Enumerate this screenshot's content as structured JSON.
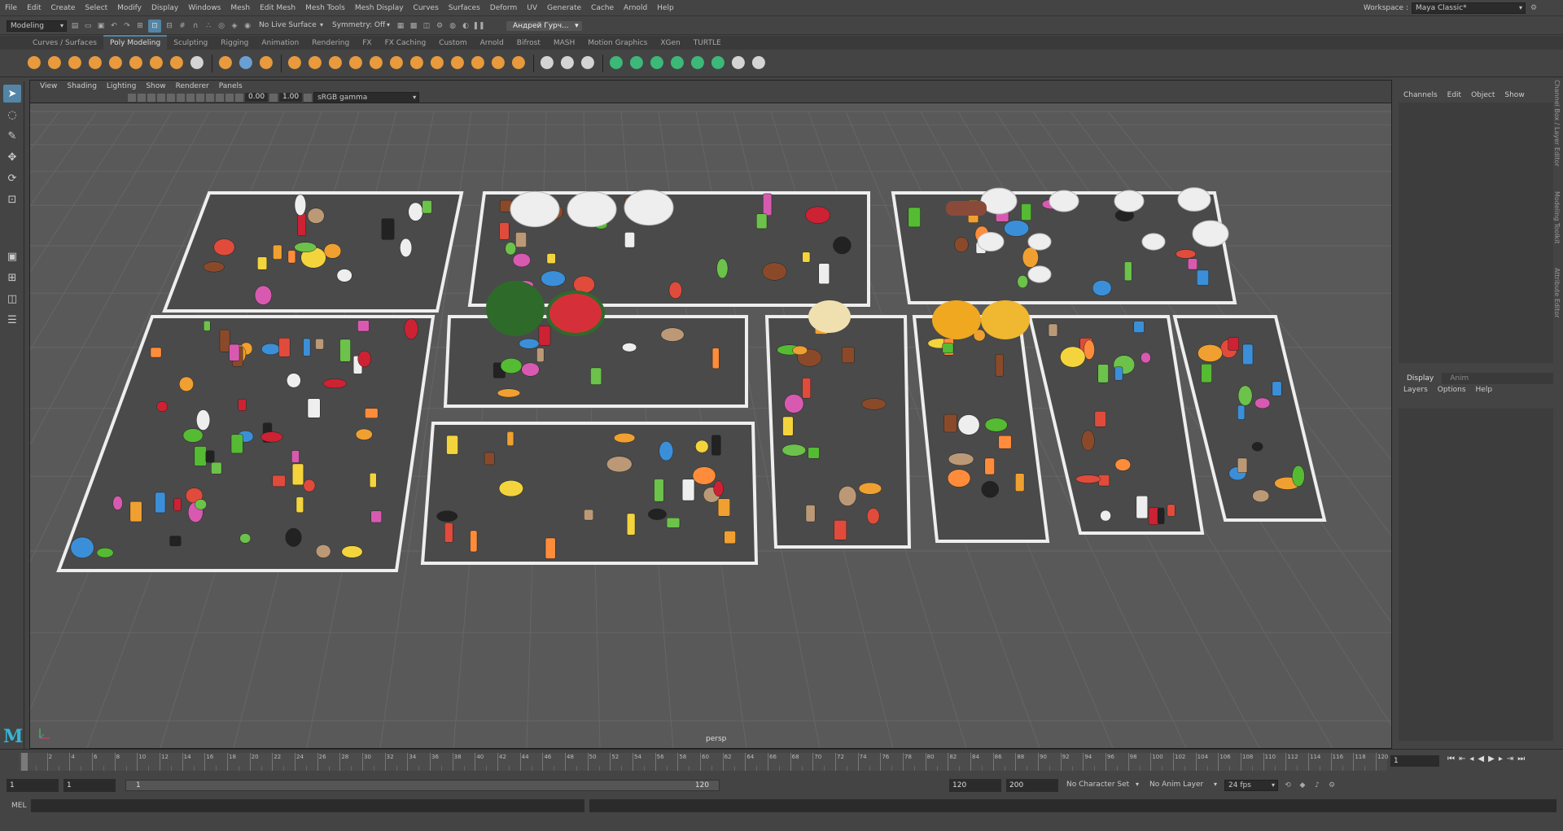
{
  "menubar": {
    "items": [
      "File",
      "Edit",
      "Create",
      "Select",
      "Modify",
      "Display",
      "Windows",
      "Mesh",
      "Edit Mesh",
      "Mesh Tools",
      "Mesh Display",
      "Curves",
      "Surfaces",
      "Deform",
      "UV",
      "Generate",
      "Cache",
      "Arnold",
      "Help"
    ],
    "workspace_label": "Workspace :",
    "workspace_value": "Maya Classic*"
  },
  "statusline": {
    "mode": "Modeling",
    "live_surface": "No Live Surface",
    "symmetry": "Symmetry: Off",
    "user": "Андрей Гурч..."
  },
  "shelf": {
    "tabs": [
      "Curves / Surfaces",
      "Poly Modeling",
      "Sculpting",
      "Rigging",
      "Animation",
      "Rendering",
      "FX",
      "FX Caching",
      "Custom",
      "Arnold",
      "Bifrost",
      "MASH",
      "Motion Graphics",
      "XGen",
      "TURTLE"
    ],
    "active_tab": "Poly Modeling",
    "icon_colors": [
      "#e89a3c",
      "#e89a3c",
      "#e89a3c",
      "#e89a3c",
      "#e89a3c",
      "#e89a3c",
      "#e89a3c",
      "#e89a3c",
      "#d4d4d4",
      "#e89a3c",
      "#6a9fd4",
      "#e89a3c",
      "#e89a3c",
      "#e89a3c",
      "#e89a3c",
      "#e89a3c",
      "#e89a3c",
      "#e89a3c",
      "#e89a3c",
      "#e89a3c",
      "#e89a3c",
      "#e89a3c",
      "#e89a3c",
      "#e89a3c",
      "#d4d4d4",
      "#d4d4d4",
      "#d4d4d4",
      "#3cb878",
      "#3cb878",
      "#3cb878",
      "#3cb878",
      "#3cb878",
      "#3cb878",
      "#d4d4d4",
      "#d4d4d4"
    ]
  },
  "viewport": {
    "menu": [
      "View",
      "Shading",
      "Lighting",
      "Show",
      "Renderer",
      "Panels"
    ],
    "field_a": "0.00",
    "field_b": "1.00",
    "color_space": "sRGB gamma",
    "camera": "persp"
  },
  "channel_box": {
    "menu": [
      "Channels",
      "Edit",
      "Object",
      "Show"
    ],
    "side_tabs": [
      "Channel Box / Layer Editor",
      "Modeling Toolkit",
      "Attribute Editor"
    ]
  },
  "layer_editor": {
    "tabs": [
      "Display",
      "Anim"
    ],
    "menu": [
      "Layers",
      "Options",
      "Help"
    ]
  },
  "timeline": {
    "labels": [
      "2",
      "4",
      "6",
      "8",
      "10",
      "12",
      "14",
      "16",
      "18",
      "20",
      "22",
      "24",
      "26",
      "28",
      "30",
      "32",
      "34",
      "36",
      "38",
      "40",
      "42",
      "44",
      "46",
      "48",
      "50",
      "52",
      "54",
      "56",
      "58",
      "60",
      "62",
      "64",
      "66",
      "68",
      "70",
      "72",
      "74",
      "76",
      "78",
      "80",
      "82",
      "84",
      "86",
      "88",
      "90",
      "92",
      "94",
      "96",
      "98",
      "100",
      "102",
      "104",
      "106",
      "108",
      "110",
      "112",
      "114",
      "116",
      "118",
      "120"
    ],
    "start_marker": "1",
    "current_frame": "1"
  },
  "range": {
    "start": "1",
    "playback_start": "1",
    "slider_start": "1",
    "slider_end": "120",
    "playback_end": "120",
    "end": "200",
    "character_set": "No Character Set",
    "anim_layer": "No Anim Layer",
    "fps": "24 fps"
  },
  "command_line": {
    "label": "MEL"
  },
  "logo": "M"
}
